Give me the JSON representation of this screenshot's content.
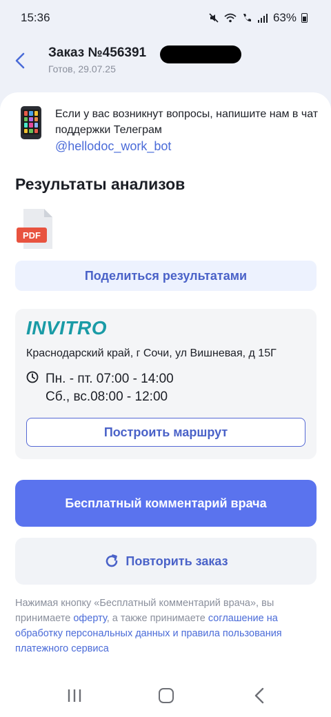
{
  "status_bar": {
    "time": "15:36",
    "battery": "63%",
    "icons": [
      "mute-icon",
      "wifi-icon",
      "wifi-call-icon",
      "signal-icon",
      "battery-icon"
    ]
  },
  "header": {
    "title": "Заказ №456391",
    "subtitle": "Готов, 29.07.25"
  },
  "support": {
    "text": "Если у вас возникнут вопросы, напишите нам в чат поддержки Телеграм",
    "link": "@hellodoc_work_bot"
  },
  "results": {
    "heading": "Результаты анализов",
    "file_label": "PDF",
    "share_label": "Поделиться результатами"
  },
  "lab": {
    "name": "INVITRO",
    "address": "Краснодарский край, г Сочи, ул Вишневая, д 15Г",
    "hours_weekday": "Пн. - пт. 07:00 - 14:00",
    "hours_weekend": "Сб., вс.08:00 - 12:00",
    "route_label": "Построить маршрут"
  },
  "actions": {
    "doctor_comment": "Бесплатный комментарий врача",
    "repeat_order": "Повторить заказ"
  },
  "legal": {
    "part1": "Нажимая кнопку «Бесплатный комментарий врача», вы принимаете ",
    "link1": "оферту",
    "part2": ", а также принимаете ",
    "link2": "соглашение на обработку персональных данных и правила пользования платежного сервиса"
  },
  "colors": {
    "accent": "#5a73ee",
    "link": "#4a6bd8",
    "invitro": "#1a9ba6",
    "pdf_badge": "#e8533f"
  }
}
